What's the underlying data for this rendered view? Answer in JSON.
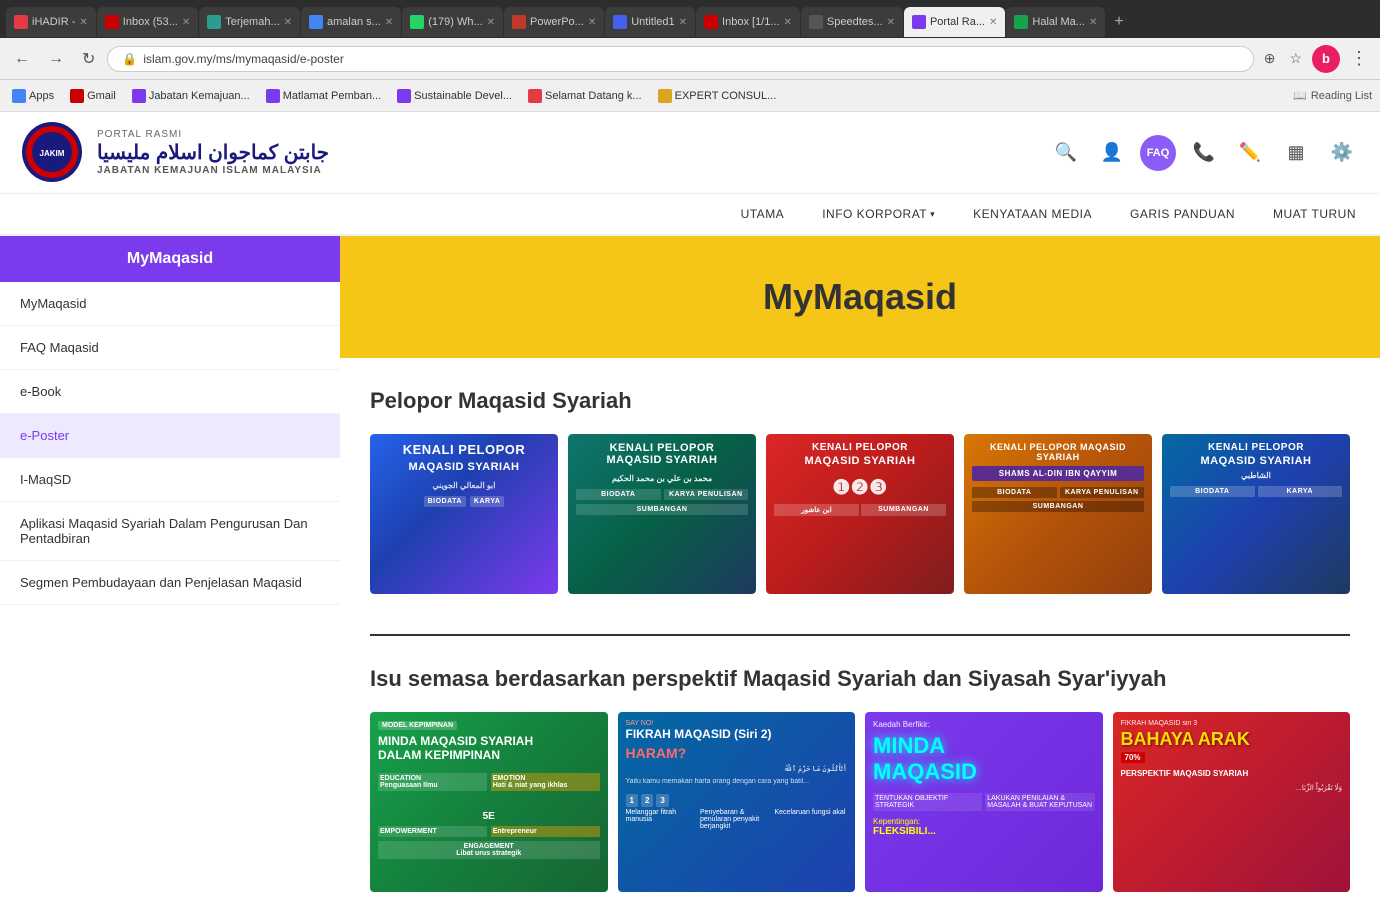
{
  "browser": {
    "tabs": [
      {
        "id": 1,
        "favicon_color": "#e63946",
        "label": "iHADIR -",
        "active": false
      },
      {
        "id": 2,
        "favicon_color": "#cc0001",
        "label": "Inbox (53...",
        "active": false
      },
      {
        "id": 3,
        "favicon_color": "#2a9d8f",
        "label": "Terjemah...",
        "active": false
      },
      {
        "id": 4,
        "favicon_color": "#4285f4",
        "label": "amalan s...",
        "active": false
      },
      {
        "id": 5,
        "favicon_color": "#25D366",
        "label": "(179) Wh...",
        "active": false
      },
      {
        "id": 6,
        "favicon_color": "#e63946",
        "label": "PowerPo...",
        "active": false
      },
      {
        "id": 7,
        "favicon_color": "#4361ee",
        "label": "Untitled1",
        "active": false
      },
      {
        "id": 8,
        "favicon_color": "#cc0001",
        "label": "Inbox [1/1...",
        "active": false
      },
      {
        "id": 9,
        "favicon_color": "#333",
        "label": "Speedtes...",
        "active": false
      },
      {
        "id": 10,
        "favicon_color": "#7c3aed",
        "label": "Portal Ra...",
        "active": true
      },
      {
        "id": 11,
        "favicon_color": "#16a34a",
        "label": "Halal Ma...",
        "active": false
      }
    ],
    "address": "islam.gov.my/ms/mymaqasid/e-poster",
    "bookmarks": [
      {
        "label": "Apps",
        "favicon_color": "#4285f4"
      },
      {
        "label": "Gmail",
        "favicon_color": "#cc0001"
      },
      {
        "label": "Jabatan Kemajuan...",
        "favicon_color": "#7c3aed"
      },
      {
        "label": "Matlamat Pemban...",
        "favicon_color": "#7c3aed"
      },
      {
        "label": "Sustainable Devel...",
        "favicon_color": "#7c3aed"
      },
      {
        "label": "Selamat Datang k...",
        "favicon_color": "#e63946"
      },
      {
        "label": "EXPERT CONSUL...",
        "favicon_color": "#daa520"
      }
    ],
    "reading_list": "Reading List"
  },
  "portal": {
    "rasmi_label": "PORTAL RASMI",
    "jakim_arabic": "جابتن كماجوان اسلام مليسيا",
    "jakim_english": "JABATAN KEMAJUAN ISLAM MALAYSIA",
    "nav_items": [
      {
        "label": "UTAMA",
        "has_dropdown": false
      },
      {
        "label": "INFO KORPORAT",
        "has_dropdown": true
      },
      {
        "label": "KENYATAAN MEDIA",
        "has_dropdown": false
      },
      {
        "label": "GARIS PANDUAN",
        "has_dropdown": false
      },
      {
        "label": "MUAT TURUN",
        "has_dropdown": false
      }
    ],
    "faq_label": "FAQ"
  },
  "sidebar": {
    "header": "MyMaqasid",
    "items": [
      {
        "label": "MyMaqasid",
        "active": false
      },
      {
        "label": "FAQ Maqasid",
        "active": false
      },
      {
        "label": "e-Book",
        "active": false
      },
      {
        "label": "e-Poster",
        "active": true
      },
      {
        "label": "I-MaqSD",
        "active": false
      },
      {
        "label": "Aplikasi Maqasid Syariah Dalam Pengurusan Dan Pentadbiran",
        "active": false
      },
      {
        "label": "Segmen Pembudayaan dan Penjelasan Maqasid",
        "active": false
      }
    ]
  },
  "main": {
    "hero_title": "MyMaqasid",
    "section1": {
      "title": "Pelopor Maqasid Syariah",
      "posters": [
        {
          "text": "KENALI PELOPOR MAQASID SYARIAH",
          "style": "poster-1"
        },
        {
          "text": "KENALI PELOPOR MAQASID SYARIAH",
          "style": "poster-2"
        },
        {
          "text": "KENALI PELOPOR MAQASID SYARIAH",
          "style": "poster-3"
        },
        {
          "text": "Kenali Pelopor Maqasid Syariah",
          "style": "poster-4"
        },
        {
          "text": "KENALI PELOPOR MAQASID SYARIAH",
          "style": "poster-5"
        }
      ]
    },
    "section2": {
      "title": "Isu semasa berdasarkan perspektif Maqasid Syariah dan Siyasah Syar'iyyah",
      "posters": [
        {
          "text": "MINDA MAQASID SYARIAH DALAM KEPIMPINAN",
          "style": "p2-1"
        },
        {
          "text": "FIKRAH MAQASID (Siri 2)",
          "style": "p2-2"
        },
        {
          "text": "MINDA MAQASID",
          "style": "p2-3"
        },
        {
          "text": "FIKRAH MAQASID siri 3 BAHAYA ARAK",
          "style": "p2-4"
        }
      ]
    }
  }
}
